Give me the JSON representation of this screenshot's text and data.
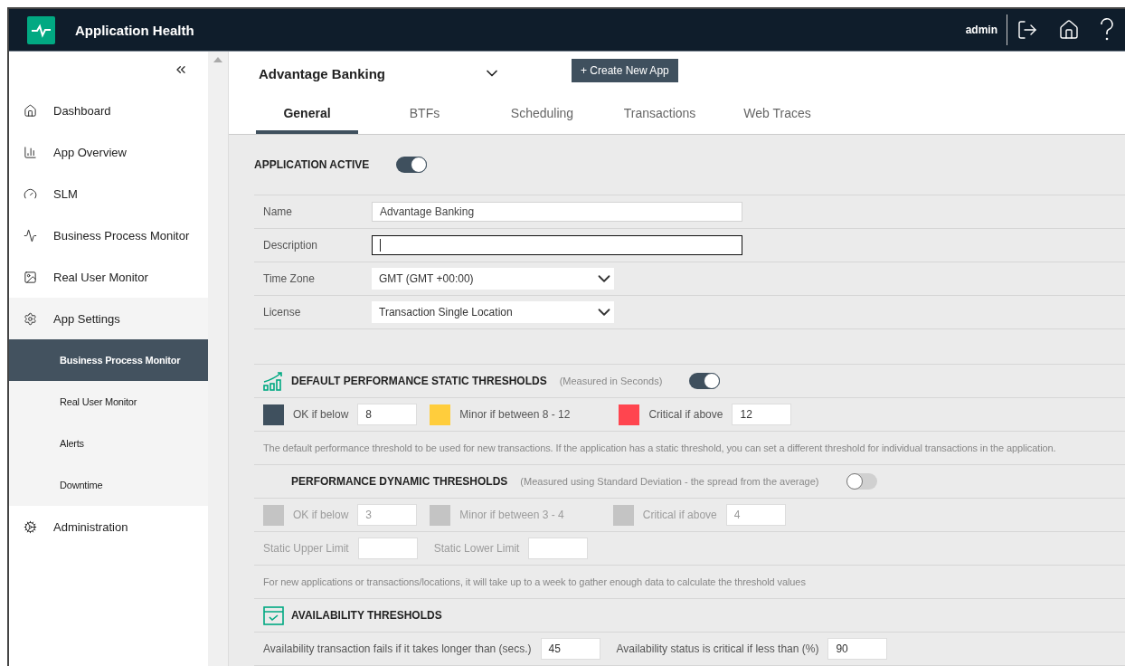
{
  "header": {
    "title": "Application Health",
    "user": "admin"
  },
  "sidebar": {
    "items": [
      {
        "label": "Dashboard",
        "selected": false
      },
      {
        "label": "App Overview",
        "selected": false
      },
      {
        "label": "SLM",
        "selected": false
      },
      {
        "label": "Business Process Monitor",
        "selected": false
      },
      {
        "label": "Real User Monitor",
        "selected": false
      },
      {
        "label": "App Settings",
        "selected": false,
        "expanded": true,
        "children": [
          {
            "label": "Business Process Monitor",
            "selected": true
          },
          {
            "label": "Real User Monitor",
            "selected": false
          },
          {
            "label": "Alerts",
            "selected": false
          },
          {
            "label": "Downtime",
            "selected": false
          }
        ]
      },
      {
        "label": "Administration",
        "selected": false
      }
    ]
  },
  "app_selector": {
    "value": "Advantage Banking"
  },
  "create_button": "+ Create New App",
  "tabs": [
    {
      "label": "General",
      "selected": true
    },
    {
      "label": "BTFs",
      "selected": false
    },
    {
      "label": "Scheduling",
      "selected": false
    },
    {
      "label": "Transactions",
      "selected": false
    },
    {
      "label": "Web Traces",
      "selected": false
    }
  ],
  "application_active": {
    "label": "APPLICATION ACTIVE",
    "on": true
  },
  "form": [
    {
      "label": "Name",
      "kind": "text",
      "value": "Advantage Banking",
      "focused": false
    },
    {
      "label": "Description",
      "kind": "text",
      "focused": true
    },
    {
      "label": "Time Zone",
      "kind": "dropdown",
      "value": "GMT (GMT +00:00)"
    },
    {
      "label": "License",
      "kind": "dropdown",
      "value": "Transaction Single Location"
    }
  ],
  "static_thresholds": {
    "title": "DEFAULT PERFORMANCE STATIC THRESHOLDS",
    "note": "(Measured in Seconds)",
    "on": true,
    "disabled": false,
    "levels": [
      {
        "label": "OK if below",
        "value": "8",
        "color": "#3f505e"
      },
      {
        "label": "Minor if between 8 - 12",
        "color": "#ffcd3c"
      },
      {
        "label": "Critical if above",
        "value": "12",
        "color": "#ff454f"
      }
    ],
    "description": "The default performance threshold to be used for new transactions. If the application has a static threshold, you can set a different threshold for individual transactions in the application."
  },
  "dynamic_thresholds": {
    "title": "PERFORMANCE DYNAMIC THRESHOLDS",
    "note": "(Measured using Standard Deviation - the spread from the average)",
    "on": false,
    "disabled": true,
    "levels": [
      {
        "label": "OK if below",
        "value": "3"
      },
      {
        "label": "Minor if between 3 - 4"
      },
      {
        "label": "Critical if above",
        "value": "4"
      }
    ],
    "limits": [
      {
        "label": "Static Upper Limit"
      },
      {
        "label": "Static Lower Limit"
      }
    ],
    "description": "For new applications or transactions/locations, it will take up to a week to gather enough data to calculate the threshold values"
  },
  "availability": {
    "title": "AVAILABILITY THRESHOLDS",
    "fields": [
      {
        "label": "Availability transaction fails if it takes longer than (secs.)",
        "value": "45"
      },
      {
        "label": "Availability status is critical if less than (%)",
        "value": "90"
      }
    ]
  }
}
